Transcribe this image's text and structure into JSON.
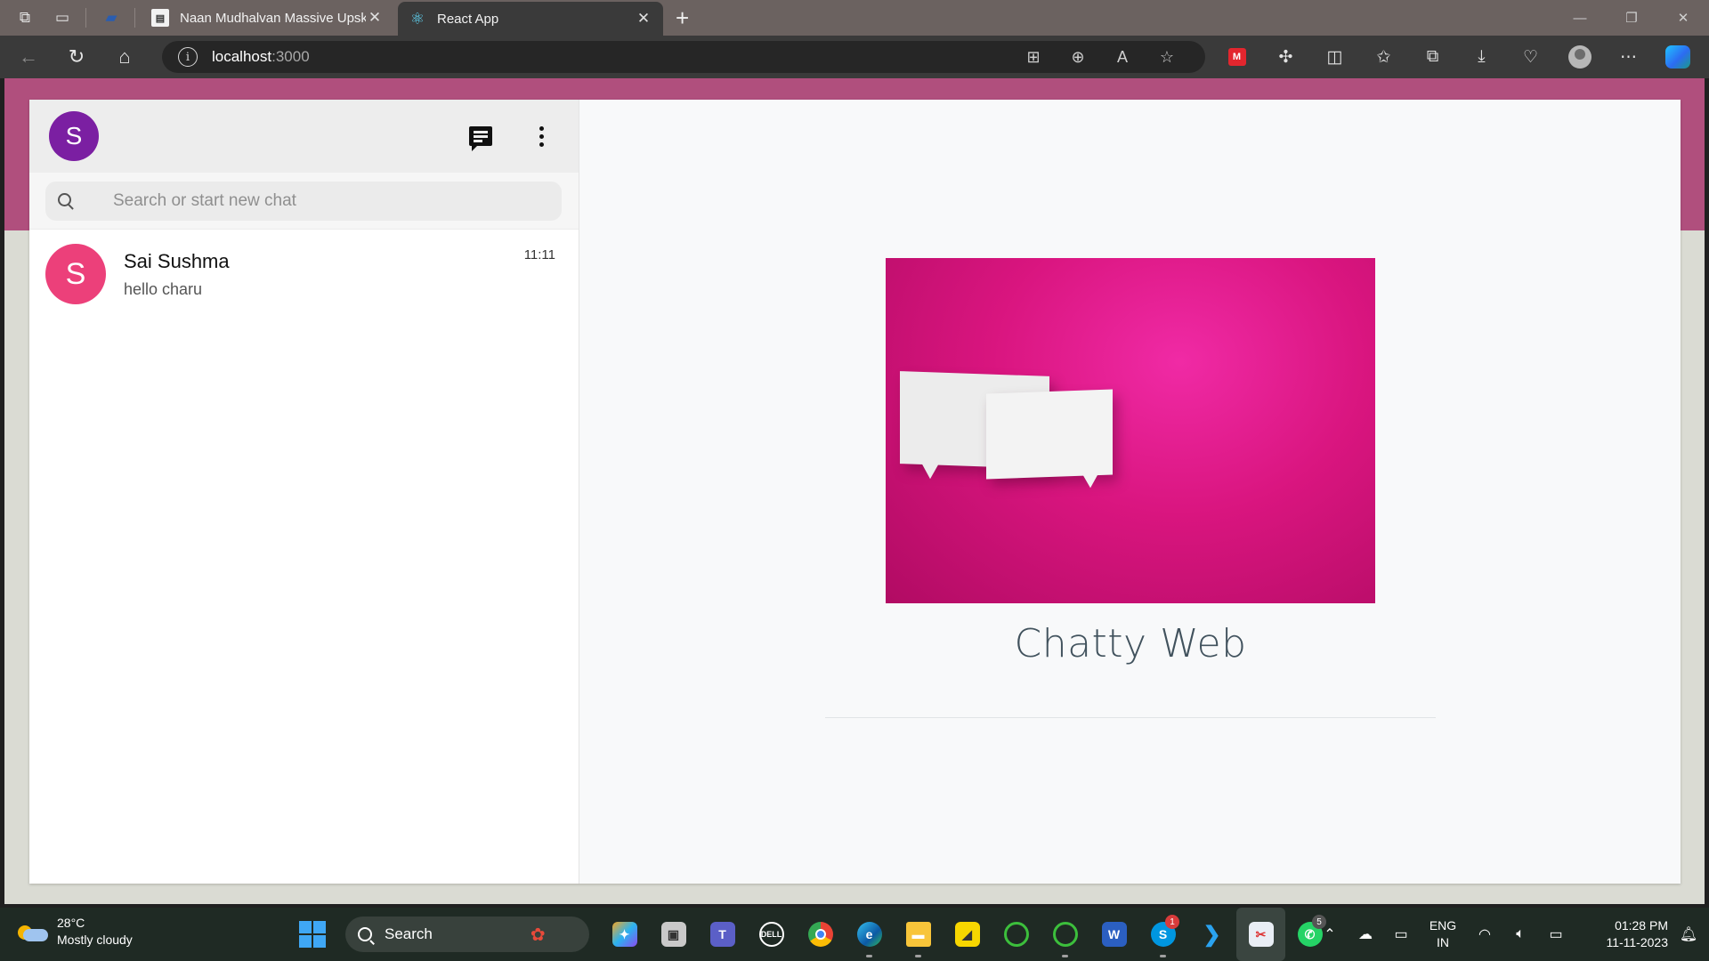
{
  "browser": {
    "tabs": [
      {
        "title": "Naan Mudhalvan Massive Upskilling",
        "active": false
      },
      {
        "title": "React App",
        "active": true
      }
    ],
    "url_host": "localhost",
    "url_port": ":3000"
  },
  "app": {
    "user_initial": "S",
    "search_placeholder": "Search or start new chat",
    "chats": [
      {
        "initial": "S",
        "name": "Sai Sushma",
        "last_message": "hello charu",
        "time": "11:11"
      }
    ],
    "brand_title": "Chatty Web",
    "colors": {
      "band": "#b04f7d",
      "user_avatar": "#7b1fa2",
      "chat_avatar": "#ec407a",
      "hero": "#d9157f"
    }
  },
  "taskbar": {
    "weather_temp": "28°C",
    "weather_desc": "Mostly cloudy",
    "search_label": "Search",
    "skype_badge": "1",
    "whatsapp_badge": "5",
    "lang_top": "ENG",
    "lang_bottom": "IN",
    "time": "01:28 PM",
    "date": "11-11-2023"
  }
}
